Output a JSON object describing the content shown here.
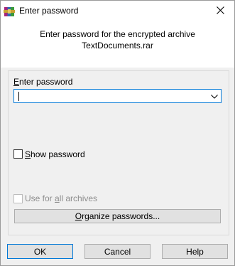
{
  "window": {
    "title": "Enter password"
  },
  "header": {
    "line1": "Enter password for the encrypted archive",
    "line2": "TextDocuments.rar"
  },
  "password": {
    "label_accel": "E",
    "label_rest": "nter password",
    "value": ""
  },
  "show_password": {
    "accel": "S",
    "rest": "how password",
    "checked": false
  },
  "use_for_all": {
    "pre": "Use for ",
    "accel": "a",
    "rest": "ll archives",
    "checked": false,
    "enabled": false
  },
  "organize": {
    "accel": "O",
    "rest": "rganize passwords..."
  },
  "buttons": {
    "ok": "OK",
    "cancel": "Cancel",
    "help": "Help"
  },
  "icons": {
    "app": "winrar-books-icon",
    "close": "close-icon",
    "dropdown": "chevron-down-icon"
  },
  "colors": {
    "focus_border": "#0078d7",
    "button_face": "#e1e1e1",
    "dialog_bg": "#f0f0f0"
  }
}
